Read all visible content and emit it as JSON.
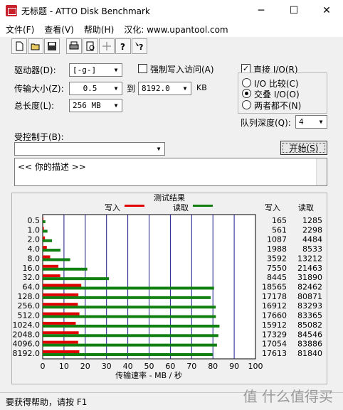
{
  "window": {
    "title": "无标题 - ATTO Disk Benchmark",
    "min": "─",
    "max": "☐",
    "close": "✕"
  },
  "menu": [
    {
      "label": "文件(F)"
    },
    {
      "label": "查看(V)"
    },
    {
      "label": "帮助(H)"
    },
    {
      "label": "汉化: www.upantool.com"
    }
  ],
  "toolbar": {
    "buttons": [
      "new-file-icon",
      "open-folder-icon",
      "save-icon",
      "print-icon",
      "print-preview-icon",
      "move-icon",
      "help-icon",
      "context-help-icon"
    ]
  },
  "settings": {
    "drive_label": "驱动器(D):",
    "drive_value": "[-g-]",
    "transfer_label": "传输大小(Z):",
    "transfer_from": "0.5",
    "to_label": "到",
    "transfer_to": "8192.0",
    "kb_label": "KB",
    "length_label": "总长度(L):",
    "length_value": "256 MB",
    "force_write_label": "强制写入访问(A)",
    "force_write_checked": false,
    "direct_io_label": "直接 I/O(R)",
    "direct_io_checked": true,
    "radio_options": [
      "I/O 比较(C)",
      "交叠 I/O(O)",
      "两者都不(N)"
    ],
    "radio_selected": 1,
    "queue_label": "队列深度(Q):",
    "queue_value": "4",
    "controlled_label": "受控制于(B):",
    "controlled_value": "",
    "start_button": "开始(S)",
    "description": "<<   你的描述   >>"
  },
  "results": {
    "title": "测试结果",
    "legend_write": "写入",
    "legend_read": "读取",
    "col_write": "写入",
    "col_read": "读取",
    "xlabel": "传输速率 - MB / 秒",
    "write_color": "#e00000",
    "read_color": "#108010"
  },
  "chart_data": {
    "type": "bar",
    "title": "测试结果",
    "xlabel": "传输速率 - MB / 秒",
    "xlim": [
      0,
      100
    ],
    "xticks": [
      0,
      10,
      20,
      30,
      40,
      50,
      60,
      70,
      80,
      90,
      100
    ],
    "categories": [
      "0.5",
      "1.0",
      "2.0",
      "4.0",
      "8.0",
      "16.0",
      "32.0",
      "64.0",
      "128.0",
      "256.0",
      "512.0",
      "1024.0",
      "2048.0",
      "4096.0",
      "8192.0"
    ],
    "series": [
      {
        "name": "写入",
        "values_kb": [
          165,
          561,
          1087,
          1988,
          3592,
          7550,
          8445,
          18565,
          17178,
          16912,
          17660,
          15912,
          17329,
          17054,
          17613
        ]
      },
      {
        "name": "读取",
        "values_kb": [
          1285,
          2298,
          4484,
          8533,
          13212,
          21463,
          31890,
          82462,
          80871,
          83293,
          83365,
          85082,
          84546,
          83886,
          81840
        ]
      }
    ],
    "grid": true
  },
  "status": {
    "text": "要获得帮助，请按 F1"
  },
  "watermark": "值 什么值得买"
}
